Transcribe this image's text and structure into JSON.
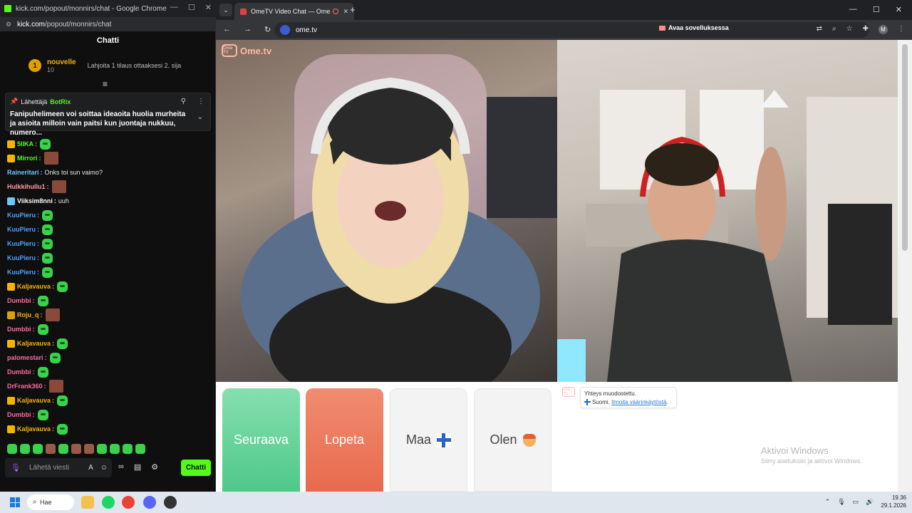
{
  "left_window": {
    "title": "kick.com/popout/monnirs/chat - Google Chrome",
    "url_host": "kick.com",
    "url_path": "/popout/monnirs/chat",
    "chat_header": "Chatti",
    "leader": {
      "rank": "1",
      "name": "nouvelle",
      "count": "10",
      "gift_text": "Lahjoita 1 tilaus ottaaksesi 2. sija"
    },
    "pinned": {
      "label": "Lähettäjä",
      "sender": "BotRix",
      "text": "Fanipuhelimeen voi soittaa ideaoita huolia murheita ja asioita milloin vain paitsi kun juontaja nukkuu, numero..."
    },
    "messages": [
      {
        "user": "5IIKA",
        "color": "#53fc18",
        "badge": "crown",
        "text": "",
        "emote": "pepe"
      },
      {
        "user": "Mirrori",
        "color": "#53fc18",
        "badge": "crown",
        "text": "",
        "emote": "face"
      },
      {
        "user": "Raineritari",
        "color": "#6ec6ff",
        "badge": "",
        "text": "Onks toi sun vaimo?",
        "emote": ""
      },
      {
        "user": "Hulkkihullu1",
        "color": "#ff9aa2",
        "badge": "",
        "text": "",
        "emote": "face"
      },
      {
        "user": "Viiksim8nni",
        "color": "#ffffff",
        "badge": "gem",
        "text": "uuh",
        "emote": ""
      },
      {
        "user": "KuuPieru",
        "color": "#4aa3ff",
        "badge": "",
        "text": "",
        "emote": "pepe"
      },
      {
        "user": "KuuPieru",
        "color": "#4aa3ff",
        "badge": "",
        "text": "",
        "emote": "pepe"
      },
      {
        "user": "KuuPieru",
        "color": "#4aa3ff",
        "badge": "",
        "text": "",
        "emote": "pepe"
      },
      {
        "user": "KuuPieru",
        "color": "#4aa3ff",
        "badge": "",
        "text": "",
        "emote": "pepe"
      },
      {
        "user": "KuuPieru",
        "color": "#4aa3ff",
        "badge": "",
        "text": "",
        "emote": "pepe"
      },
      {
        "user": "Kaljavauva",
        "color": "#f5b400",
        "badge": "crown",
        "text": "",
        "emote": "pepe"
      },
      {
        "user": "Dumbbi",
        "color": "#ff6b9a",
        "badge": "",
        "text": "",
        "emote": "pepe"
      },
      {
        "user": "Roju_q",
        "color": "#f5b400",
        "badge": "medal",
        "text": "",
        "emote": "face"
      },
      {
        "user": "Dumbbi",
        "color": "#ff6b9a",
        "badge": "",
        "text": "",
        "emote": "pepe"
      },
      {
        "user": "Kaljavauva",
        "color": "#f5b400",
        "badge": "crown",
        "text": "",
        "emote": "pepe"
      },
      {
        "user": "palomestari",
        "color": "#ff6b9a",
        "badge": "",
        "text": "",
        "emote": "pepe"
      },
      {
        "user": "Dumbbi",
        "color": "#ff6b9a",
        "badge": "",
        "text": "",
        "emote": "pepe"
      },
      {
        "user": "DrFrank360",
        "color": "#ff6b9a",
        "badge": "",
        "text": "",
        "emote": "face"
      },
      {
        "user": "Kaljavauva",
        "color": "#f5b400",
        "badge": "crown",
        "text": "",
        "emote": "pepe"
      },
      {
        "user": "Dumbbi",
        "color": "#ff6b9a",
        "badge": "",
        "text": "",
        "emote": "pepe"
      },
      {
        "user": "Kaljavauva",
        "color": "#f5b400",
        "badge": "crown",
        "text": "",
        "emote": "pepe"
      }
    ],
    "input_placeholder": "Lähetä viesti",
    "send_label": "Chatti"
  },
  "browser": {
    "tab_title": "OmeTV Video Chat — Ome",
    "omnibox_url": "ome.tv",
    "open_app_label": "Avaa sovelluksessa",
    "profile_initial": "M"
  },
  "ometv": {
    "brand": "Ome.tv",
    "logo_text": "Ome TV",
    "buttons": {
      "next": "Seuraava",
      "stop": "Lopeta",
      "country": "Maa",
      "gender": "Olen"
    },
    "system_message": {
      "line1": "Yhteys muodostettu.",
      "country": "Suomi.",
      "report_link": "Ilmoita väärinkäytöstä"
    },
    "activate_windows": {
      "title": "Aktivoi Windows",
      "subtitle": "Siirry asetuksiin ja aktivoi Windows."
    }
  },
  "taskbar": {
    "search_label": "Hae",
    "time": "19.36",
    "date": "29.1.2026"
  },
  "colors": {
    "kick_green": "#53fc18",
    "next_green": "#5ccf95",
    "stop_orange": "#e9765a"
  }
}
